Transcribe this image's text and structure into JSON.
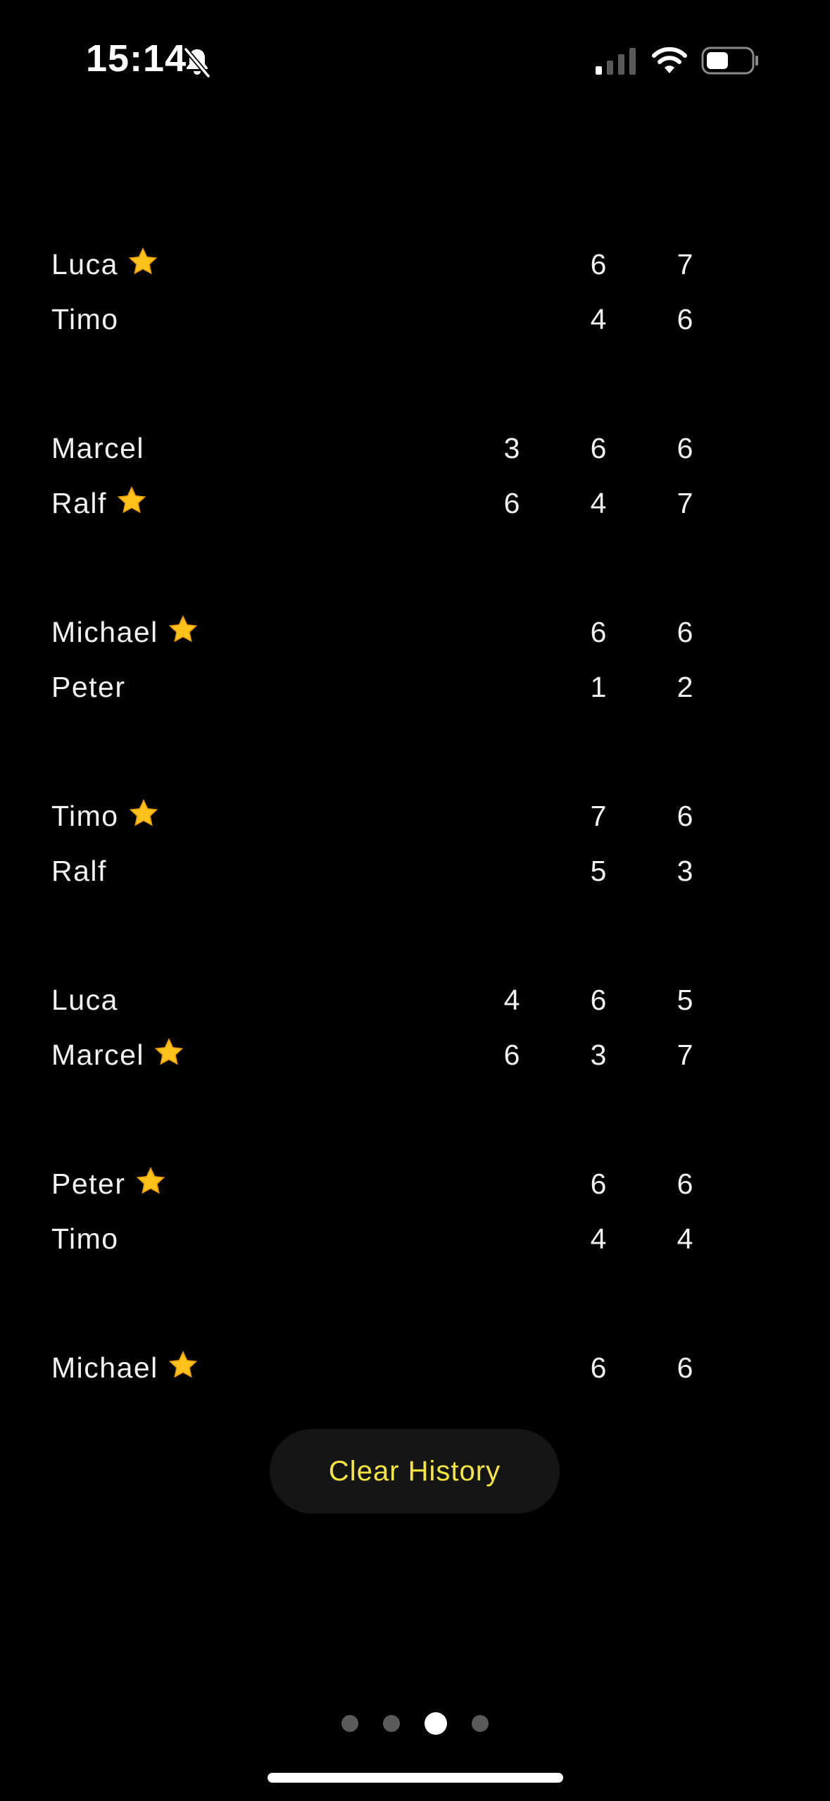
{
  "status_bar": {
    "time": "15:14",
    "icons": [
      "bell-slash-icon",
      "cellular-signal-icon",
      "wifi-icon",
      "battery-icon"
    ]
  },
  "history": {
    "matches": [
      {
        "players": [
          {
            "name": "Luca",
            "winner": true,
            "scores": [
              "",
              "6",
              "7"
            ]
          },
          {
            "name": "Timo",
            "winner": false,
            "scores": [
              "",
              "4",
              "6"
            ]
          }
        ]
      },
      {
        "players": [
          {
            "name": "Marcel",
            "winner": false,
            "scores": [
              "3",
              "6",
              "6"
            ]
          },
          {
            "name": "Ralf",
            "winner": true,
            "scores": [
              "6",
              "4",
              "7"
            ]
          }
        ]
      },
      {
        "players": [
          {
            "name": "Michael",
            "winner": true,
            "scores": [
              "",
              "6",
              "6"
            ]
          },
          {
            "name": "Peter",
            "winner": false,
            "scores": [
              "",
              "1",
              "2"
            ]
          }
        ]
      },
      {
        "players": [
          {
            "name": "Timo",
            "winner": true,
            "scores": [
              "",
              "7",
              "6"
            ]
          },
          {
            "name": "Ralf",
            "winner": false,
            "scores": [
              "",
              "5",
              "3"
            ]
          }
        ]
      },
      {
        "players": [
          {
            "name": "Luca",
            "winner": false,
            "scores": [
              "4",
              "6",
              "5"
            ]
          },
          {
            "name": "Marcel",
            "winner": true,
            "scores": [
              "6",
              "3",
              "7"
            ]
          }
        ]
      },
      {
        "players": [
          {
            "name": "Peter",
            "winner": true,
            "scores": [
              "",
              "6",
              "6"
            ]
          },
          {
            "name": "Timo",
            "winner": false,
            "scores": [
              "",
              "4",
              "4"
            ]
          }
        ]
      },
      {
        "players": [
          {
            "name": "Michael",
            "winner": true,
            "scores": [
              "",
              "6",
              "6"
            ]
          },
          {
            "name": "",
            "winner": false,
            "scores": [
              "",
              "",
              ""
            ]
          }
        ]
      }
    ]
  },
  "clear_button": {
    "label": "Clear History"
  },
  "pagination": {
    "page_count": 4,
    "current_page": 3
  },
  "colors": {
    "background": "#000000",
    "text": "#f2f2f2",
    "accent": "#f5e63d",
    "button_bg": "#151515",
    "dot_inactive": "#5a5a5a",
    "dot_active": "#ffffff"
  }
}
